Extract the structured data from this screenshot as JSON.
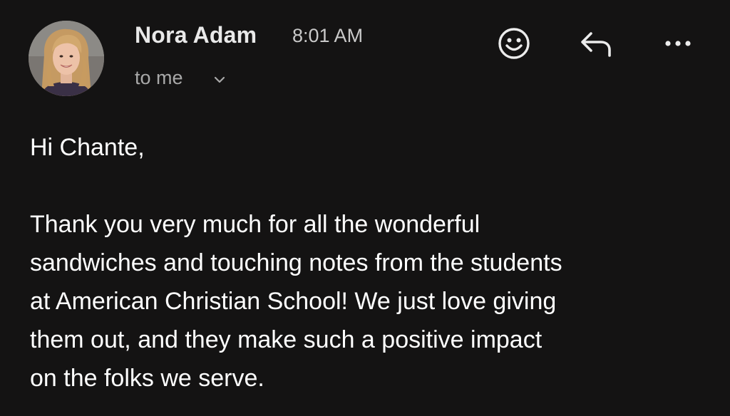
{
  "header": {
    "sender_name": "Nora Adam",
    "time": "8:01 AM",
    "recipient": "to me"
  },
  "icons": {
    "avatar": "sender-avatar",
    "recipient_toggle": "chevron-down-icon",
    "react": "emoji-icon",
    "reply": "reply-icon",
    "more": "more-horizontal-icon"
  },
  "message": {
    "greeting": "Hi Chante,",
    "paragraph_lines": [
      "Thank you very much for all the wonderful",
      "sandwiches and touching notes from the students",
      "at American Christian School! We just love giving",
      "them out, and they make such a positive impact",
      "on the folks we serve."
    ]
  },
  "colors": {
    "background": "#141313",
    "text_primary": "#ffffff",
    "text_secondary": "#a9a9a9"
  }
}
